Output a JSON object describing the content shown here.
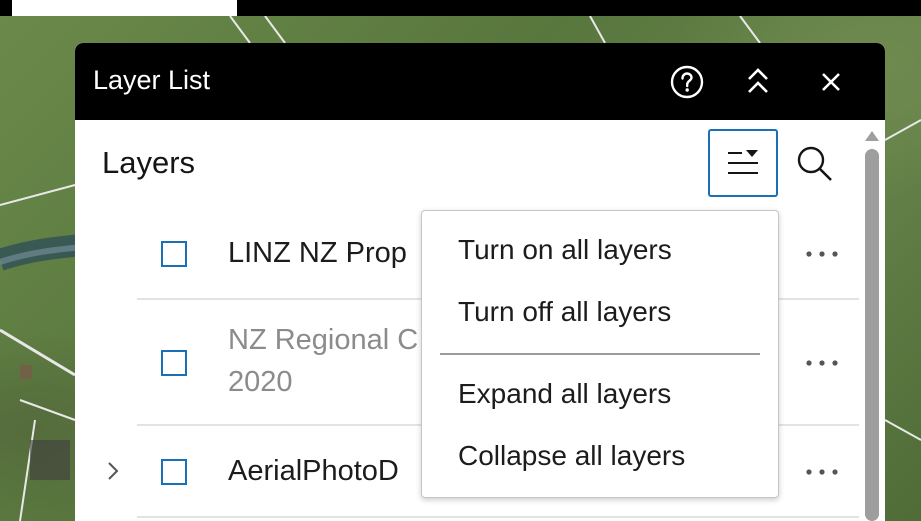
{
  "panel": {
    "title": "Layer List",
    "help_icon": "help-circle-icon",
    "collapse_icon": "chevrons-up-icon",
    "close_icon": "close-icon"
  },
  "layers": {
    "heading": "Layers",
    "options_icon": "layer-list-options-icon",
    "search_icon": "search-icon",
    "items": [
      {
        "label": "LINZ NZ Prop",
        "checked": false,
        "dimmed": false,
        "expandable": false
      },
      {
        "label": "NZ Regional C",
        "label_line2": "2020",
        "checked": false,
        "dimmed": true,
        "expandable": false
      },
      {
        "label": "AerialPhotoD",
        "checked": false,
        "dimmed": false,
        "expandable": true
      }
    ]
  },
  "menu": {
    "turn_on": "Turn on all layers",
    "turn_off": "Turn off all layers",
    "expand": "Expand all layers",
    "collapse": "Collapse all layers"
  },
  "colors": {
    "accent": "#1a6fb5",
    "header_bg": "#000000",
    "dim_text": "#8b8b8b"
  }
}
